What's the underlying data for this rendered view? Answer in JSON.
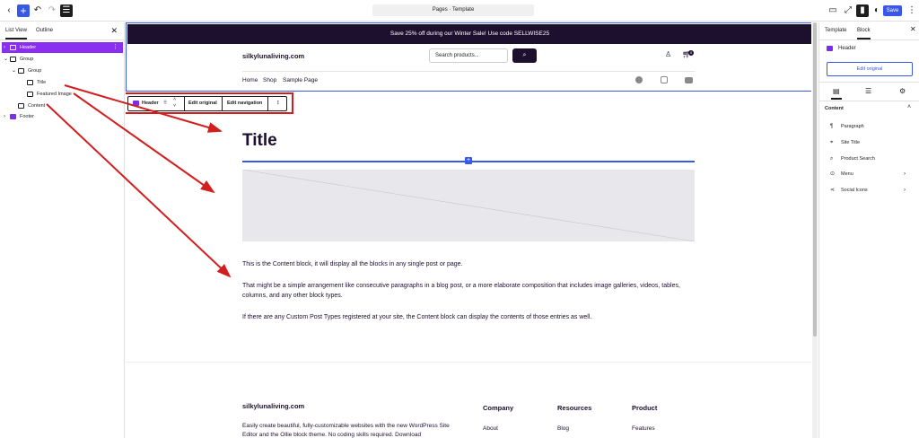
{
  "topbar": {
    "document_title": "Pages · Template",
    "save_label": "Save"
  },
  "left_panel": {
    "tabs": [
      "List View",
      "Outline"
    ],
    "tree": [
      {
        "label": "Header",
        "selected": true
      },
      {
        "label": "Group"
      },
      {
        "label": "Group"
      },
      {
        "label": "Title"
      },
      {
        "label": "Featured Image"
      },
      {
        "label": "Content"
      },
      {
        "label": "Footer"
      }
    ]
  },
  "header_part": {
    "promo": "Save 25% off during our Winter Sale! Use code SELLWISE25",
    "site_title": "silkylunaliving.com",
    "search_placeholder": "Search products...",
    "cart_count": "0",
    "nav": [
      "Home",
      "Shop",
      "Sample Page"
    ]
  },
  "block_toolbar": {
    "block_label": "Header",
    "edit_original": "Edit original",
    "edit_navigation": "Edit navigation"
  },
  "content": {
    "title": "Title",
    "paragraphs": [
      "This is the Content block, it will display all the blocks in any single post or page.",
      "That might be a simple arrangement like consecutive paragraphs in a blog post, or a more elaborate composition that includes image galleries, videos, tables, columns, and any other block types.",
      "If there are any Custom Post Types registered at your site, the Content block can display the contents of those entries as well."
    ]
  },
  "footer_part": {
    "site_title": "silkylunaliving.com",
    "description": "Easily create beautiful, fully-customizable websites with the new WordPress Site Editor and the Ollie block theme. No coding skills required. Download",
    "columns": [
      {
        "heading": "Company",
        "first_item": "About"
      },
      {
        "heading": "Resources",
        "first_item": "Blog"
      },
      {
        "heading": "Product",
        "first_item": "Features"
      }
    ]
  },
  "right_panel": {
    "tabs": [
      "Template",
      "Block"
    ],
    "block_name": "Header",
    "edit_original": "Edit original",
    "section_title": "Content",
    "items": [
      "Paragraph",
      "Site Title",
      "Product Search",
      "Menu",
      "Social Icons"
    ]
  },
  "colors": {
    "accent": "#3858e9",
    "brand_dark": "#1d0f2e",
    "selection_purple": "#8a2ef0",
    "annotation_red": "#d21e1e"
  }
}
